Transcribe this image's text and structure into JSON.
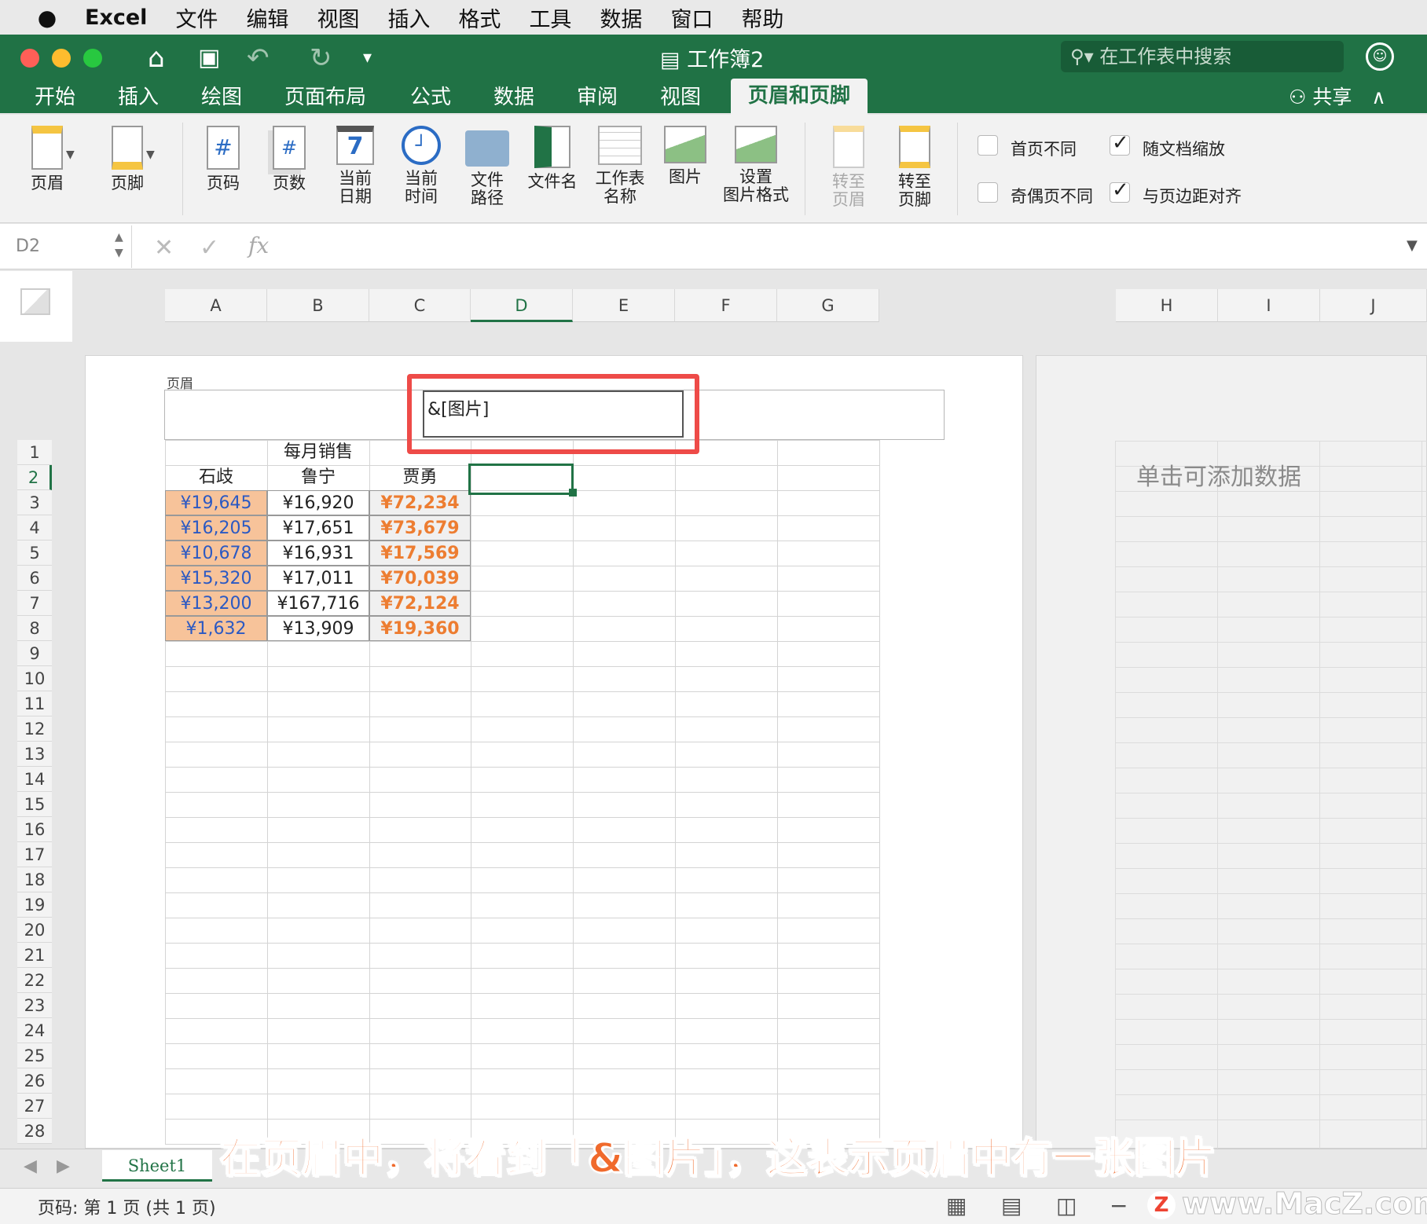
{
  "menubar": {
    "app": "Excel",
    "items": [
      "文件",
      "编辑",
      "视图",
      "插入",
      "格式",
      "工具",
      "数据",
      "窗口",
      "帮助"
    ]
  },
  "title": {
    "document": "工作簿2"
  },
  "search": {
    "placeholder": "在工作表中搜索"
  },
  "tabs": [
    "开始",
    "插入",
    "绘图",
    "页面布局",
    "公式",
    "数据",
    "审阅",
    "视图",
    "页眉和页脚"
  ],
  "share": {
    "label": "共享"
  },
  "ribbon": {
    "header": "页眉",
    "footer": "页脚",
    "page_number": "页码",
    "page_count": "页数",
    "current_date": [
      "当前",
      "日期"
    ],
    "current_time": [
      "当前",
      "时间"
    ],
    "file_path": [
      "文件",
      "路径"
    ],
    "file_name": "文件名",
    "sheet_name": [
      "工作表",
      "名称"
    ],
    "picture": "图片",
    "format_picture": [
      "设置",
      "图片格式"
    ],
    "goto_header": [
      "转至",
      "页眉"
    ],
    "goto_footer": [
      "转至",
      "页脚"
    ],
    "date_icon_text": "7",
    "page_icon_text": "#",
    "options": [
      {
        "label": "首页不同",
        "checked": false
      },
      {
        "label": "奇偶页不同",
        "checked": false
      },
      {
        "label": "随文档缩放",
        "checked": true
      },
      {
        "label": "与页边距对齐",
        "checked": true
      }
    ]
  },
  "formula_bar": {
    "name_box": "D2",
    "fx": "fx"
  },
  "columns": [
    "A",
    "B",
    "C",
    "D",
    "E",
    "F",
    "G"
  ],
  "columns_page2": [
    "H",
    "I",
    "J"
  ],
  "rows": [
    "1",
    "2",
    "3",
    "4",
    "5",
    "6",
    "7",
    "8",
    "9",
    "10",
    "11",
    "12",
    "13",
    "14",
    "15",
    "16",
    "17",
    "18",
    "19",
    "20",
    "21",
    "22",
    "23",
    "24",
    "25",
    "26",
    "27",
    "28"
  ],
  "header_area": {
    "label": "页眉",
    "center_text": "&[图片]"
  },
  "table": {
    "title": "每月销售",
    "headers": [
      "石歧",
      "鲁宁",
      "贾勇"
    ],
    "rows": [
      [
        "¥19,645",
        "¥16,920",
        "¥72,234"
      ],
      [
        "¥16,205",
        "¥17,651",
        "¥73,679"
      ],
      [
        "¥10,678",
        "¥16,931",
        "¥17,569"
      ],
      [
        "¥15,320",
        "¥17,011",
        "¥70,039"
      ],
      [
        "¥13,200",
        "¥167,716",
        "¥72,124"
      ],
      [
        "¥1,632",
        "¥13,909",
        "¥19,360"
      ]
    ]
  },
  "page2_hint": "单击可添加数据",
  "sheet_tab": "Sheet1",
  "status": {
    "page_info": "页码: 第 1 页 (共 1 页)"
  },
  "caption": "在页眉中，将看到「&图片」，这表示页眉中有一张图片",
  "watermark": "www.MacZ.com",
  "colors": {
    "excel_green": "#217346",
    "titlebar": "#207245",
    "highlight_red": "#ee4b48",
    "caption_orange": "#f06a2c",
    "cell_orange": "#f7c39a",
    "bold_orange": "#ed7d31"
  }
}
